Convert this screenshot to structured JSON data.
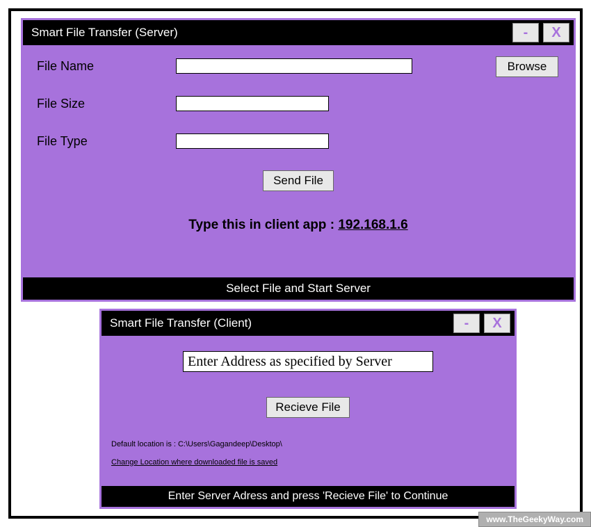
{
  "server": {
    "title": "Smart File Transfer (Server)",
    "minimize": "-",
    "close": "X",
    "labels": {
      "filename": "File Name",
      "filesize": "File Size",
      "filetype": "File Type"
    },
    "values": {
      "filename": "",
      "filesize": "",
      "filetype": ""
    },
    "browse": "Browse",
    "send": "Send File",
    "instruction_prefix": "Type this in client app : ",
    "ip": "192.168.1.6",
    "status": "Select File and Start Server"
  },
  "client": {
    "title": "Smart File Transfer (Client)",
    "minimize": "-",
    "close": "X",
    "address_value": "Enter Address as specified by Server",
    "recieve": "Recieve File",
    "default_location": "Default location is : C:\\Users\\Gagandeep\\Desktop\\",
    "change_location": "Change Location where downloaded file is saved ",
    "status": "Enter Server Adress and press 'Recieve File' to Continue"
  },
  "watermark": "www.TheGeekyWay.com"
}
